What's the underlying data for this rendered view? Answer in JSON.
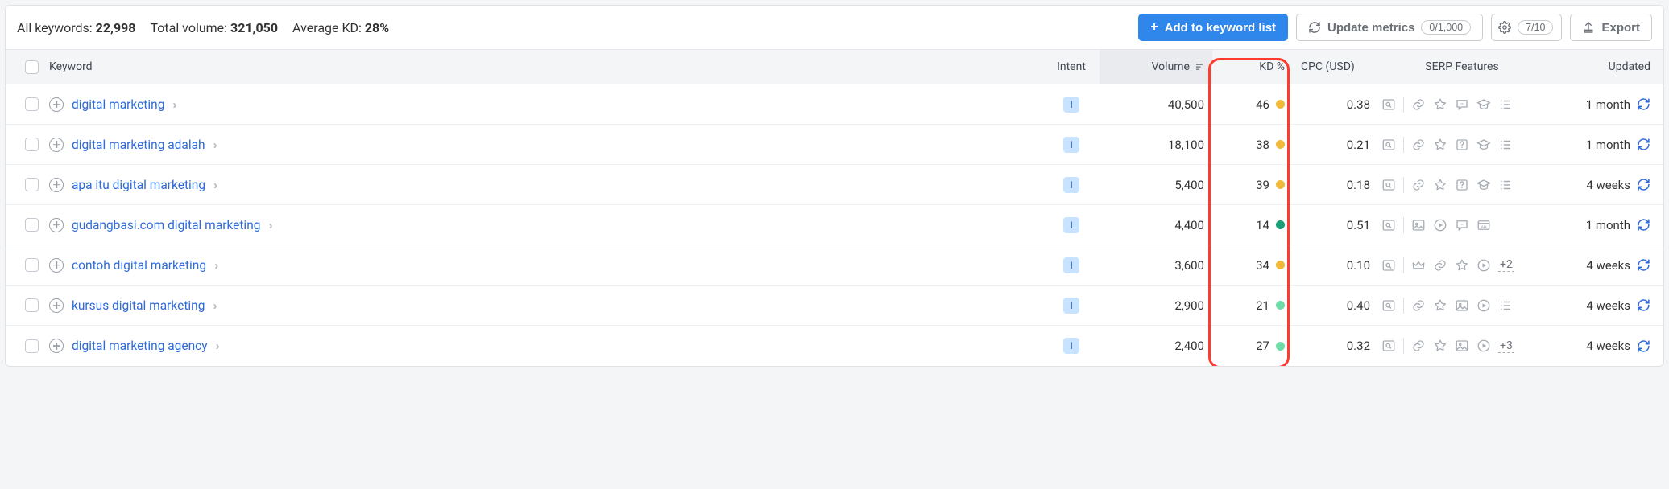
{
  "summary": {
    "all_keywords_label": "All keywords:",
    "all_keywords_value": "22,998",
    "total_volume_label": "Total volume:",
    "total_volume_value": "321,050",
    "avg_kd_label": "Average KD:",
    "avg_kd_value": "28%"
  },
  "actions": {
    "add_to_list": "Add to keyword list",
    "update_metrics": "Update metrics",
    "update_count": "0/1,000",
    "settings_count": "7/10",
    "export": "Export"
  },
  "columns": {
    "keyword": "Keyword",
    "intent": "Intent",
    "volume": "Volume",
    "kd": "KD %",
    "cpc": "CPC (USD)",
    "serp": "SERP Features",
    "updated": "Updated"
  },
  "rows": [
    {
      "keyword": "digital marketing",
      "intent": "I",
      "volume": "40,500",
      "kd": "46",
      "kd_color": "#f0b93a",
      "cpc": "0.38",
      "serp_icons": [
        "serp-search",
        "link",
        "star",
        "chat",
        "edu",
        "list"
      ],
      "serp_overflow": "",
      "updated": "1 month"
    },
    {
      "keyword": "digital marketing adalah",
      "intent": "I",
      "volume": "18,100",
      "kd": "38",
      "kd_color": "#f0b93a",
      "cpc": "0.21",
      "serp_icons": [
        "serp-search",
        "link",
        "star",
        "faq",
        "edu",
        "list"
      ],
      "serp_overflow": "",
      "updated": "1 month"
    },
    {
      "keyword": "apa itu digital marketing",
      "intent": "I",
      "volume": "5,400",
      "kd": "39",
      "kd_color": "#f0b93a",
      "cpc": "0.18",
      "serp_icons": [
        "serp-search",
        "link",
        "star",
        "faq",
        "edu",
        "list"
      ],
      "serp_overflow": "",
      "updated": "4 weeks"
    },
    {
      "keyword": "gudangbasi.com digital marketing",
      "intent": "I",
      "volume": "4,400",
      "kd": "14",
      "kd_color": "#1a9e77",
      "cpc": "0.51",
      "serp_icons": [
        "serp-search",
        "image",
        "video",
        "chat",
        "site"
      ],
      "serp_overflow": "",
      "updated": "1 month"
    },
    {
      "keyword": "contoh digital marketing",
      "intent": "I",
      "volume": "3,600",
      "kd": "34",
      "kd_color": "#f0b93a",
      "cpc": "0.10",
      "serp_icons": [
        "serp-search",
        "crown",
        "link",
        "star",
        "video"
      ],
      "serp_overflow": "+2",
      "updated": "4 weeks"
    },
    {
      "keyword": "kursus digital marketing",
      "intent": "I",
      "volume": "2,900",
      "kd": "21",
      "kd_color": "#6fdca8",
      "cpc": "0.40",
      "serp_icons": [
        "serp-search",
        "link",
        "star",
        "image",
        "video",
        "list"
      ],
      "serp_overflow": "",
      "updated": "4 weeks"
    },
    {
      "keyword": "digital marketing agency",
      "intent": "I",
      "volume": "2,400",
      "kd": "27",
      "kd_color": "#6fdca8",
      "cpc": "0.32",
      "serp_icons": [
        "serp-search",
        "link",
        "star",
        "image",
        "video"
      ],
      "serp_overflow": "+3",
      "updated": "4 weeks"
    }
  ]
}
